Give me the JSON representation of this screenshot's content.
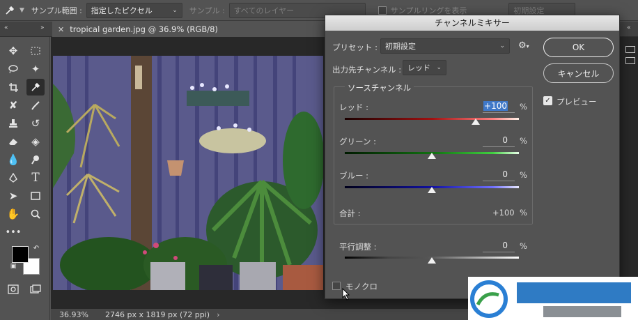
{
  "options_bar": {
    "sample_range_label": "サンプル範囲 :",
    "sample_range_value": "指定したピクセル",
    "sample_label": "サンプル :",
    "sample_value": "すべてのレイヤー",
    "show_ring_label": "サンプルリングを表示",
    "reset_label": "初期設定"
  },
  "document_tab": {
    "title": "tropical garden.jpg @ 36.9% (RGB/8)"
  },
  "status_bar": {
    "zoom": "36.93%",
    "doc_info": "2746 px x 1819 px (72 ppi)"
  },
  "dialog": {
    "title": "チャンネルミキサー",
    "preset_label": "プリセット :",
    "preset_value": "初期設定",
    "output_channel_label": "出力先チャンネル :",
    "output_channel_value": "レッド",
    "source_group_label": "ソースチャンネル",
    "red_label": "レッド :",
    "red_value": "+100",
    "green_label": "グリーン :",
    "green_value": "0",
    "blue_label": "ブルー :",
    "blue_value": "0",
    "total_label": "合計 :",
    "total_value": "+100",
    "constant_label": "平行調整 :",
    "constant_value": "0",
    "percent": "%",
    "monochrome_label": "モノクロ",
    "ok_label": "OK",
    "cancel_label": "キャンセル",
    "preview_label": "プレビュー",
    "sliders": {
      "red": 100,
      "green": 0,
      "blue": 0,
      "constant": 0
    },
    "slider_range": [
      -200,
      200
    ]
  },
  "colors": {
    "ui_bg": "#535353",
    "accent": "#3f78c8",
    "foreground_swatch": "#000000",
    "background_swatch": "#ffffff"
  },
  "icons": [
    "eyedropper-icon",
    "move-icon",
    "marquee-icon",
    "lasso-icon",
    "magic-wand-icon",
    "crop-icon",
    "eyedropper-tool-icon",
    "healing-icon",
    "brush-icon",
    "stamp-icon",
    "history-brush-icon",
    "eraser-icon",
    "bucket-icon",
    "blur-icon",
    "dodge-icon",
    "pen-icon",
    "type-icon",
    "path-select-icon",
    "rectangle-icon",
    "hand-icon",
    "zoom-icon",
    "more-icon",
    "gear-icon",
    "chevron-down-icon",
    "close-icon"
  ]
}
